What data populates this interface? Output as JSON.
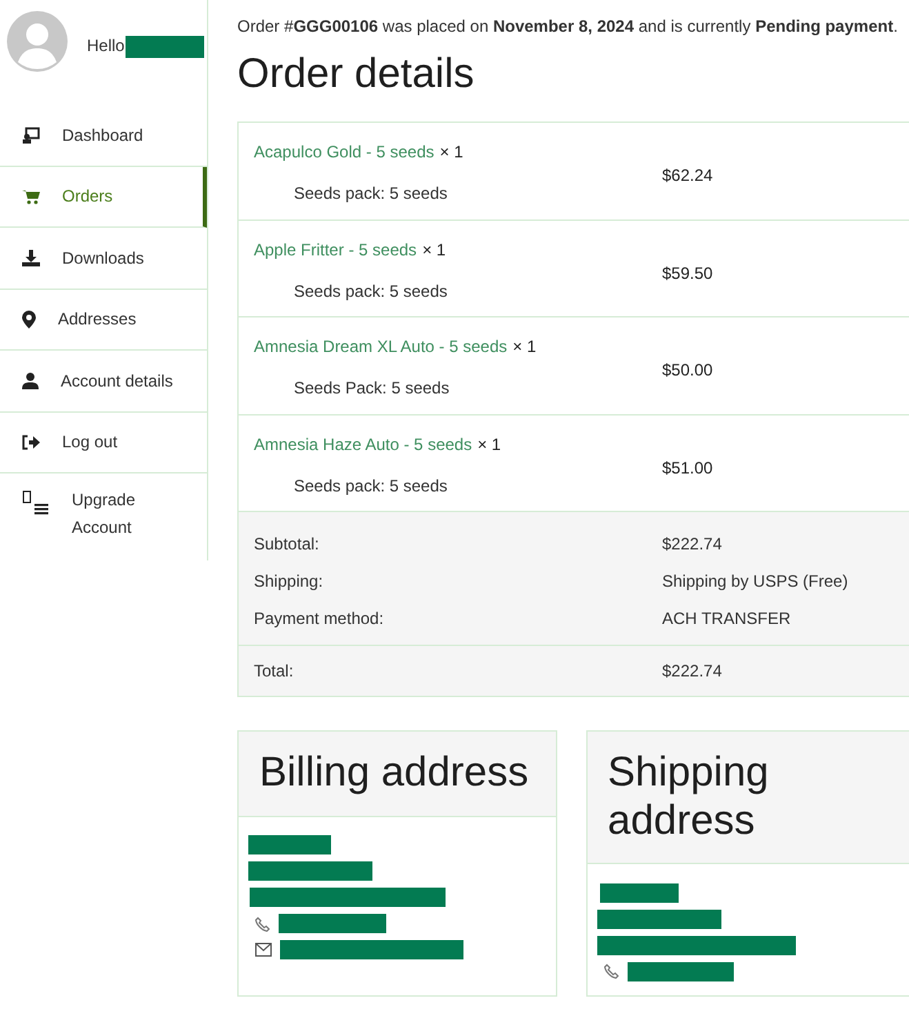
{
  "user": {
    "greeting": "Hello",
    "name_redacted": true
  },
  "sidebar": {
    "items": [
      {
        "label": "Dashboard",
        "selected": false
      },
      {
        "label": "Orders",
        "selected": true
      },
      {
        "label": "Downloads",
        "selected": false
      },
      {
        "label": "Addresses",
        "selected": false
      },
      {
        "label": "Account details",
        "selected": false
      },
      {
        "label": "Log out",
        "selected": false
      },
      {
        "label": "Upgrade Account",
        "selected": false
      }
    ]
  },
  "order_notice": "Order #**GGG00106** was placed on **November 8, 2024** and is currently **Pending payment**.",
  "heading": "Order details",
  "items": [
    {
      "product": "Acapulco Gold - 5 seeds",
      "quantity": "× 1",
      "meta": "Seeds pack: 5 seeds",
      "total": "$62.24"
    },
    {
      "product": "Apple Fritter - 5 seeds",
      "quantity": "× 1",
      "meta": "Seeds pack: 5 seeds",
      "total": "$59.50"
    },
    {
      "product": "Amnesia Dream XL Auto - 5 seeds",
      "quantity": "× 1",
      "meta": "Seeds Pack: 5 seeds",
      "total": "$50.00"
    },
    {
      "product": "Amnesia Haze Auto - 5 seeds",
      "quantity": "× 1",
      "meta": "Seeds pack: 5 seeds",
      "total": "$51.00"
    }
  ],
  "totals": [
    {
      "label": "Subtotal:",
      "value": "$222.74",
      "kind": "detail"
    },
    {
      "label": "Shipping:",
      "value": "Shipping by USPS (Free)",
      "kind": "detail"
    },
    {
      "label": "Payment method:",
      "value": "ACH TRANSFER",
      "kind": "detail"
    },
    {
      "label": "Total:",
      "value": "$222.74",
      "kind": "total"
    }
  ],
  "billing_address": {
    "title": "Billing address",
    "lines": [
      {
        "kind": "redacted"
      },
      {
        "kind": "redacted"
      },
      {
        "kind": "redacted"
      },
      {
        "kind": "phone"
      },
      {
        "kind": "email"
      }
    ]
  },
  "shipping_address": {
    "title": "Shipping address",
    "lines": [
      {
        "kind": "redacted"
      },
      {
        "kind": "redacted"
      },
      {
        "kind": "redacted"
      },
      {
        "kind": "phone"
      }
    ]
  }
}
